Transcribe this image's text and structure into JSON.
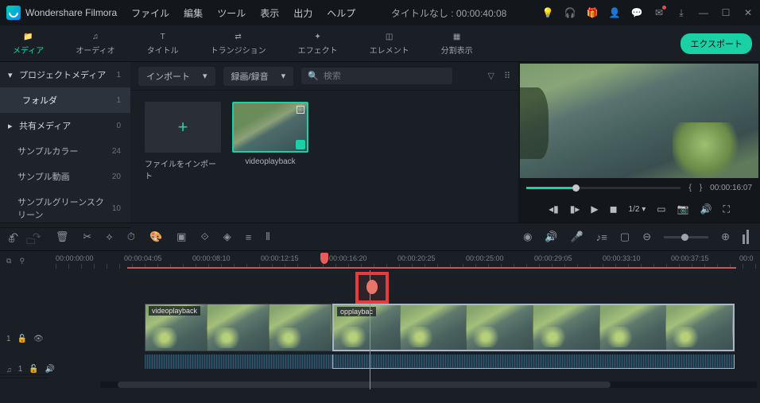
{
  "titlebar": {
    "brand": "Wondershare Filmora",
    "menus": [
      "ファイル",
      "編集",
      "ツール",
      "表示",
      "出力",
      "ヘルプ"
    ],
    "center": "タイトルなし : 00:00:40:08"
  },
  "tabs": {
    "items": [
      {
        "label": "メディア"
      },
      {
        "label": "オーディオ"
      },
      {
        "label": "タイトル"
      },
      {
        "label": "トランジション"
      },
      {
        "label": "エフェクト"
      },
      {
        "label": "エレメント"
      },
      {
        "label": "分割表示"
      }
    ],
    "export": "エクスポート"
  },
  "sidebar": {
    "items": [
      {
        "label": "プロジェクトメディア",
        "count": "1",
        "header": true
      },
      {
        "label": "フォルダ",
        "count": "1",
        "selected": true
      },
      {
        "label": "共有メディア",
        "count": "0",
        "header": true
      },
      {
        "label": "サンプルカラー",
        "count": "24"
      },
      {
        "label": "サンプル動画",
        "count": "20"
      },
      {
        "label": "サンプルグリーンスクリーン",
        "count": "10"
      }
    ]
  },
  "media_toolbar": {
    "import": "インポート",
    "record": "録画/録音",
    "search_placeholder": "検索"
  },
  "media_grid": {
    "import_label": "ファイルをインポート",
    "clip_label": "videoplayback"
  },
  "preview": {
    "timecode": "00:00:16:07",
    "pages": "1/2",
    "braces_l": "{",
    "braces_r": "}"
  },
  "ruler": {
    "ticks": [
      "00:00:00:00",
      "00:00:04:05",
      "00:00:08:10",
      "00:00:12:15",
      "00:00:16:20",
      "00:00:20:25",
      "00:00:25:00",
      "00:00:29:05",
      "00:00:33:10",
      "00:00:37:15",
      "00:0"
    ]
  },
  "timeline": {
    "clip1_label": "videoplayback",
    "clip2_label": "opplaybac"
  },
  "track_heads": {
    "video": "1",
    "audio": "1"
  }
}
